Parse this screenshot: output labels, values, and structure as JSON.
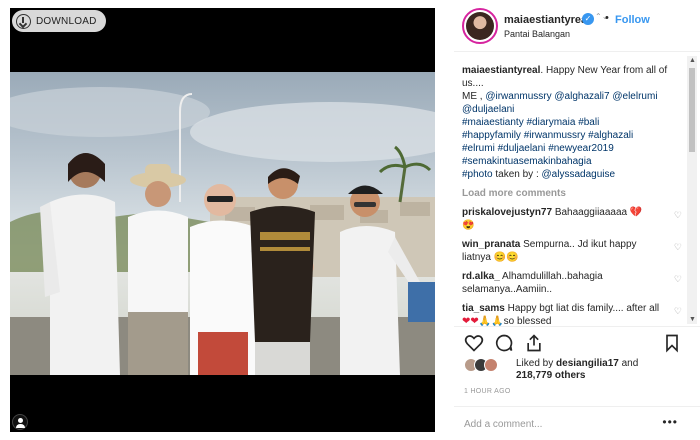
{
  "media": {
    "download_label": "DOWNLOAD"
  },
  "post_header": {
    "username": "maiaestiantyreal",
    "follow_label": "Follow",
    "location": "Pantai Balangan"
  },
  "caption": {
    "username": "maiaestiantyreal",
    "line1": ". Happy New Year from all of us....",
    "line2": "ME , ",
    "mentions": [
      "@irwanmussry",
      "@alghazali7",
      "@elelrumi",
      "@duljaelani"
    ],
    "hashtags": [
      "#maiaestianty",
      "#diarymaia",
      "#bali",
      "#happyfamily",
      "#irwanmussry",
      "#alghazali",
      "#elrumi",
      "#duljaelani",
      "#newyear2019",
      "#semakintuasemakinbahagia",
      "#photo"
    ],
    "photo_credit_text": " taken by : ",
    "photo_credit_mention": "@alyssadaguise"
  },
  "load_more_label": "Load more comments",
  "comments": [
    {
      "username": "priskalovejustyn77",
      "text": "Bahaaggiiaaaaa"
    },
    {
      "username": "win_pranata",
      "text": "Sempurna.. Jd ikut happy liatnya"
    },
    {
      "username": "rd.alka_",
      "text": "Alhamdulillah..bahagia selamanya..Aamiin.."
    },
    {
      "username": "tia_sams",
      "text": "Happy bgt liat dis family.... after all",
      "tail": "so blessed"
    }
  ],
  "likes": {
    "prefix": "Liked by ",
    "username": "desiangilia17",
    "middle": " and",
    "count_text": "218,779 others"
  },
  "timestamp": "1 HOUR AGO",
  "add_comment_placeholder": "Add a comment...",
  "more_label": "•••",
  "colors": {
    "link_blue": "#3897f0",
    "hashtag_blue": "#003569",
    "gray_text": "#999999"
  }
}
